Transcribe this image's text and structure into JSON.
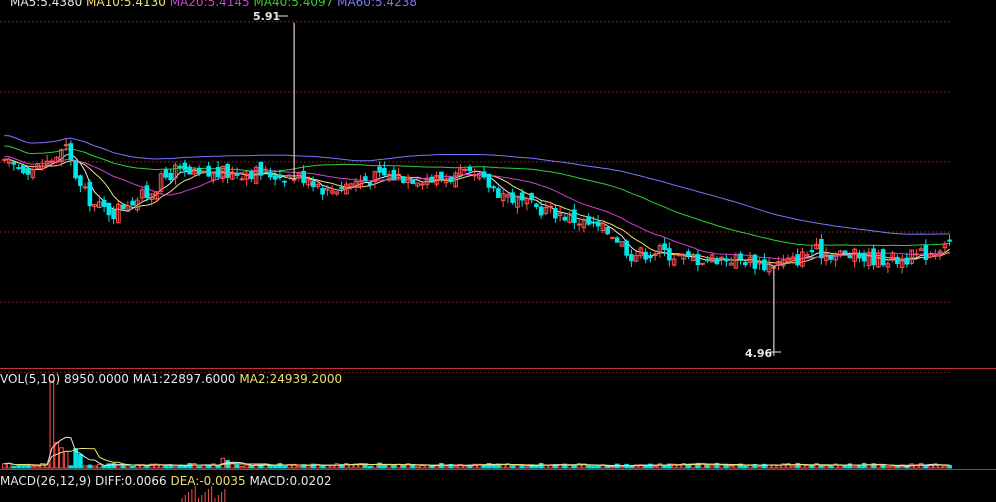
{
  "colors": {
    "background": "#000000",
    "up": "#ff5050",
    "down": "#00e5e5",
    "grid": "#8b1a1a",
    "ma5": "#e8e8e8",
    "ma10": "#e8e070",
    "ma20": "#d040d0",
    "ma40": "#30d030",
    "ma60": "#7878ff",
    "vol_ma1": "#e8e8e8",
    "vol_ma2": "#e8e070",
    "text_white": "#e8e8e8"
  },
  "price_header": [
    {
      "text": "MA5:5.4380",
      "color": "#e8e8e8"
    },
    {
      "text": "MA10:5.4130",
      "color": "#e8e070"
    },
    {
      "text": "MA20:5.4145",
      "color": "#d040d0"
    },
    {
      "text": "MA40:5.4097",
      "color": "#30d030"
    },
    {
      "text": "MA60:5.4238",
      "color": "#7878ff"
    }
  ],
  "volume_header": [
    {
      "text": "VOL(5,10) 8950.0000",
      "color": "#e8e8e8"
    },
    {
      "text": "MA1:22897.6000",
      "color": "#e8e8e8"
    },
    {
      "text": "MA2:24939.2000",
      "color": "#e8e070"
    }
  ],
  "macd_header": [
    {
      "text": "MACD(26,12,9)",
      "color": "#e8e8e8"
    },
    {
      "text": "DIFF:0.0066",
      "color": "#e8e8e8"
    },
    {
      "text": "DEA:-0.0035",
      "color": "#e8e070"
    },
    {
      "text": "MACD:0.0202",
      "color": "#e8e8e8"
    }
  ],
  "chart_data": {
    "type": "candlestick",
    "price_ylim": [
      4.925,
      5.975
    ],
    "gridlines_price": [
      5.913,
      5.713,
      5.513,
      5.313,
      5.113,
      4.913
    ],
    "annotations": [
      {
        "text": "5.91",
        "value": 5.91,
        "anchor": "high"
      },
      {
        "text": "4.96",
        "value": 4.96,
        "anchor": "low"
      }
    ],
    "ma_window_labels": [
      "MA5",
      "MA10",
      "MA20",
      "MA40",
      "MA60"
    ],
    "vol_ylim": [
      0,
      120000
    ],
    "ma_periods": [
      5,
      10,
      20,
      40,
      60
    ],
    "close_keyframes": [
      [
        0,
        5.505
      ],
      [
        6,
        5.495
      ],
      [
        9,
        5.51
      ],
      [
        13,
        5.55
      ],
      [
        16,
        5.44
      ],
      [
        19,
        5.39
      ],
      [
        23,
        5.37
      ],
      [
        26,
        5.4
      ],
      [
        30,
        5.42
      ],
      [
        33,
        5.46
      ],
      [
        36,
        5.49
      ],
      [
        40,
        5.47
      ],
      [
        45,
        5.48
      ],
      [
        52,
        5.485
      ],
      [
        58,
        5.475
      ],
      [
        64,
        5.47
      ],
      [
        68,
        5.43
      ],
      [
        72,
        5.45
      ],
      [
        80,
        5.475
      ],
      [
        86,
        5.47
      ],
      [
        91,
        5.465
      ],
      [
        96,
        5.475
      ],
      [
        100,
        5.465
      ],
      [
        104,
        5.43
      ],
      [
        110,
        5.39
      ],
      [
        116,
        5.37
      ],
      [
        122,
        5.34
      ],
      [
        128,
        5.31
      ],
      [
        132,
        5.25
      ],
      [
        138,
        5.26
      ],
      [
        144,
        5.235
      ],
      [
        150,
        5.24
      ],
      [
        156,
        5.235
      ],
      [
        160,
        5.22
      ],
      [
        163,
        5.225
      ],
      [
        166,
        5.23
      ],
      [
        170,
        5.26
      ],
      [
        176,
        5.25
      ],
      [
        182,
        5.24
      ],
      [
        188,
        5.235
      ],
      [
        192,
        5.245
      ],
      [
        196,
        5.26
      ],
      [
        198,
        5.29
      ]
    ],
    "volume_spikes": [
      {
        "bar": 10,
        "value": 116000
      },
      {
        "bar": 11,
        "value": 34000
      },
      {
        "bar": 12,
        "value": 27000
      },
      {
        "bar": 13,
        "value": 22000
      },
      {
        "bar": 15,
        "value": 26000
      },
      {
        "bar": 16,
        "value": 18000
      },
      {
        "bar": 46,
        "value": 13000
      },
      {
        "bar": 47,
        "value": 10000
      }
    ]
  }
}
